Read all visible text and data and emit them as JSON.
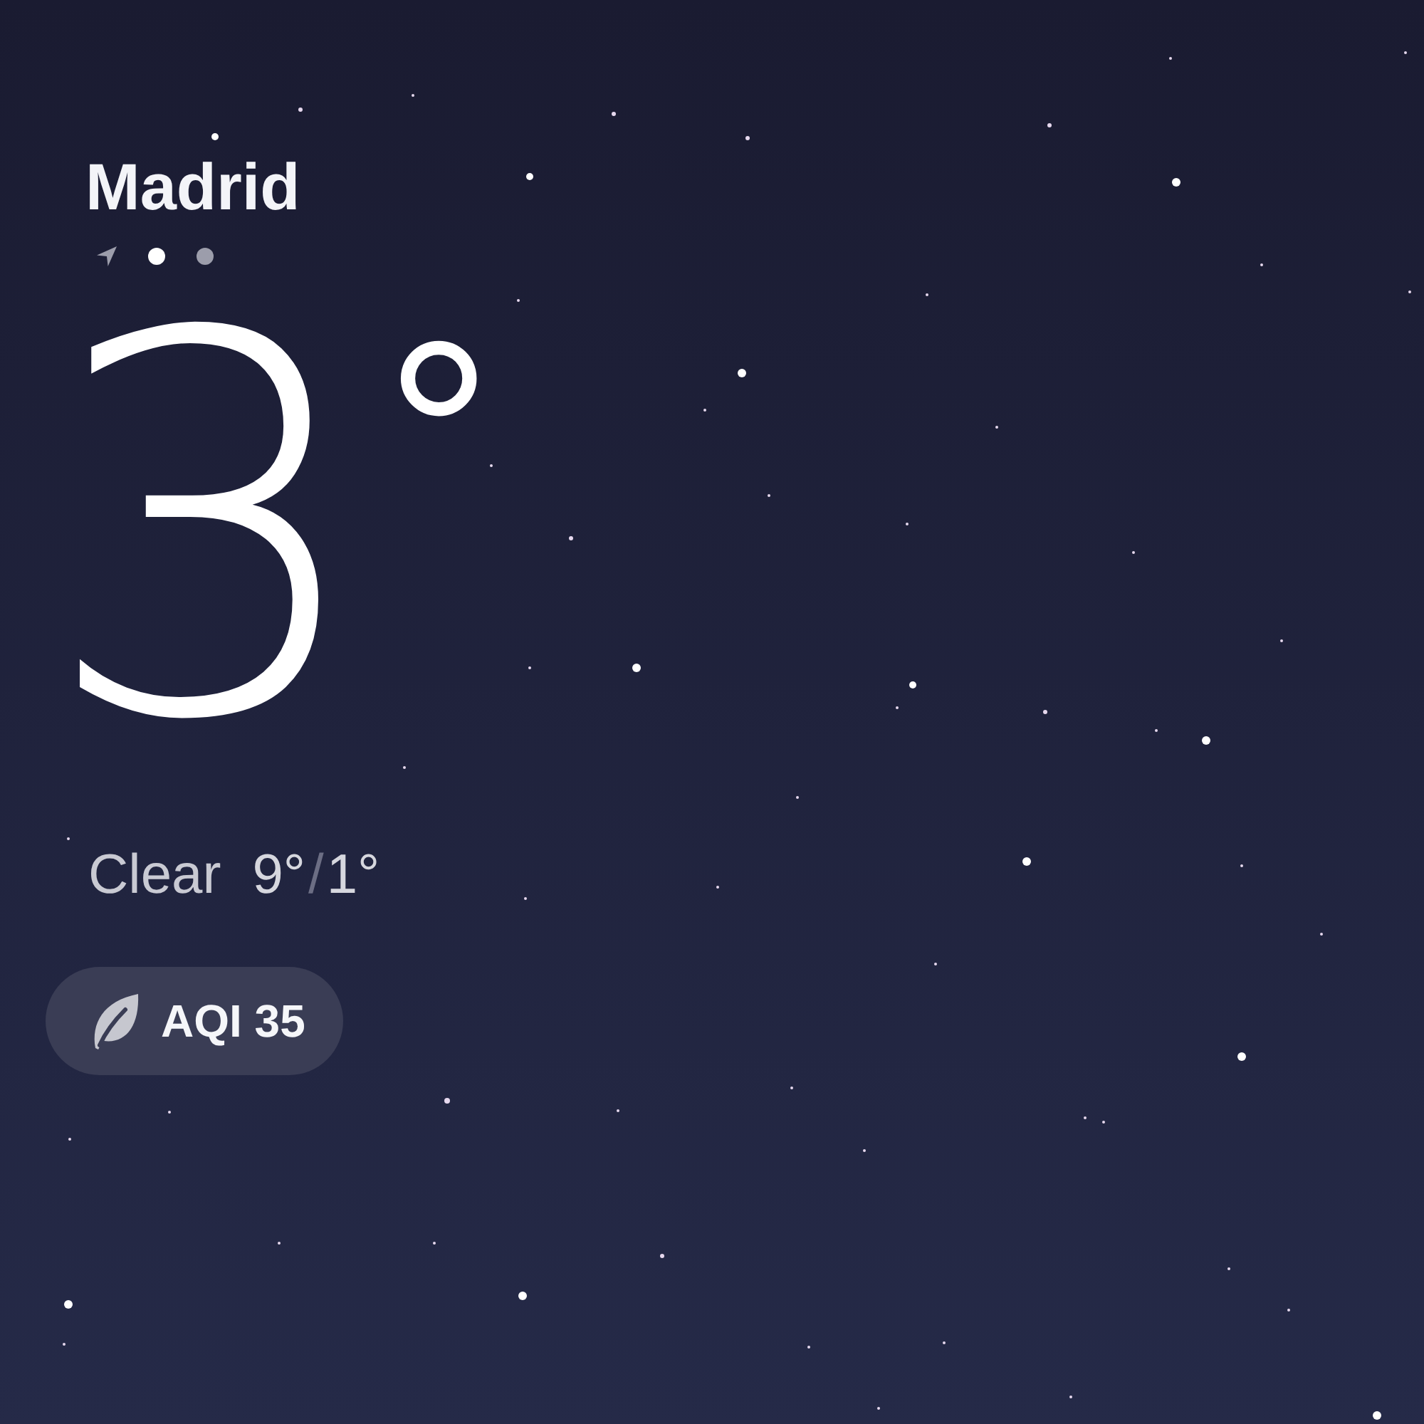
{
  "location": {
    "city": "Madrid",
    "pages": [
      {
        "kind": "location",
        "selected": false
      },
      {
        "kind": "dot",
        "selected": true
      },
      {
        "kind": "dot",
        "selected": false
      }
    ]
  },
  "current": {
    "temperature": "3",
    "unit": "°",
    "condition": "Clear",
    "high": "9°",
    "separator": "/",
    "low": "1°"
  },
  "air_quality": {
    "label": "AQI 35"
  }
}
